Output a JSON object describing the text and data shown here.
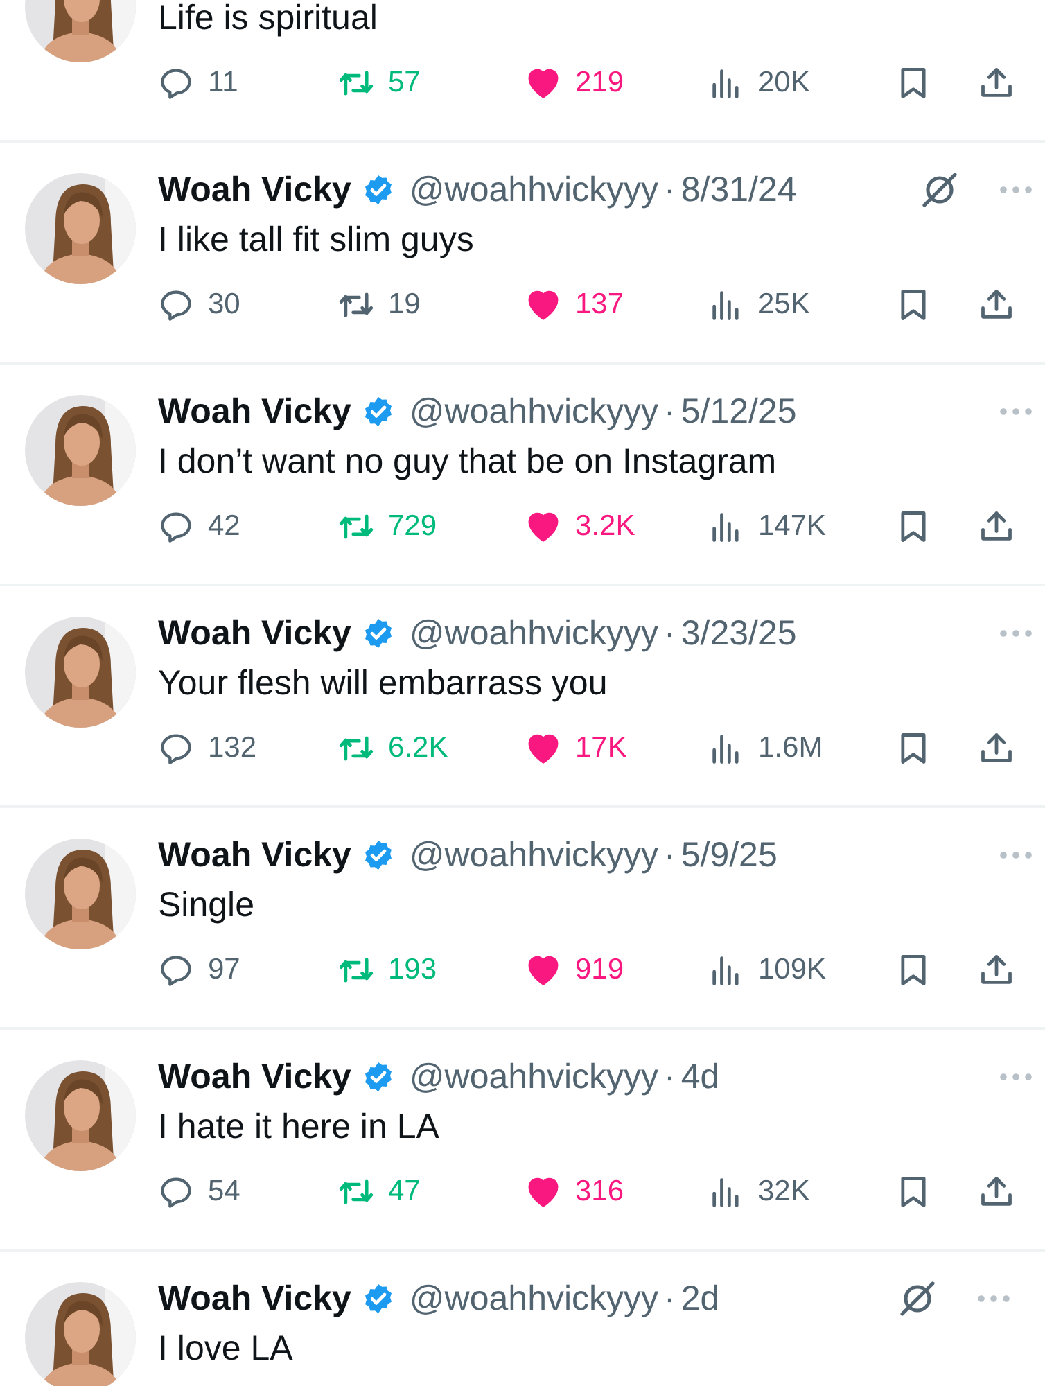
{
  "tweets": [
    {
      "text": "Life is spiritual",
      "grok_icon": false,
      "replies": "11",
      "reposts": "57",
      "reposted": true,
      "likes": "219",
      "liked": true,
      "views": "20K"
    },
    {
      "name": "Woah Vicky",
      "verified": true,
      "handle": "@woahhvickyyy",
      "separator": "·",
      "time": "8/31/24",
      "grok_icon": true,
      "text": "I like tall fit slim guys",
      "replies": "30",
      "reposts": "19",
      "reposted": false,
      "likes": "137",
      "liked": true,
      "views": "25K"
    },
    {
      "name": "Woah Vicky",
      "verified": true,
      "handle": "@woahhvickyyy",
      "separator": "·",
      "time": "5/12/25",
      "grok_icon": false,
      "text": "I don’t want no guy that be on Instagram",
      "replies": "42",
      "reposts": "729",
      "reposted": true,
      "likes": "3.2K",
      "liked": true,
      "views": "147K"
    },
    {
      "name": "Woah Vicky",
      "verified": true,
      "handle": "@woahhvickyyy",
      "separator": "·",
      "time": "3/23/25",
      "grok_icon": false,
      "text": "Your flesh will embarrass you",
      "replies": "132",
      "reposts": "6.2K",
      "reposted": true,
      "likes": "17K",
      "liked": true,
      "views": "1.6M"
    },
    {
      "name": "Woah Vicky",
      "verified": true,
      "handle": "@woahhvickyyy",
      "separator": "·",
      "time": "5/9/25",
      "grok_icon": false,
      "text": "Single",
      "replies": "97",
      "reposts": "193",
      "reposted": true,
      "likes": "919",
      "liked": true,
      "views": "109K"
    },
    {
      "name": "Woah Vicky",
      "verified": true,
      "handle": "@woahhvickyyy",
      "separator": "·",
      "time": "4d",
      "grok_icon": false,
      "text": "I hate it here in LA",
      "replies": "54",
      "reposts": "47",
      "reposted": true,
      "likes": "316",
      "liked": true,
      "views": "32K"
    },
    {
      "name": "Woah Vicky",
      "verified": true,
      "handle": "@woahhvickyyy",
      "separator": "·",
      "time": "2d",
      "grok_icon": true,
      "text": "I love LA"
    }
  ]
}
